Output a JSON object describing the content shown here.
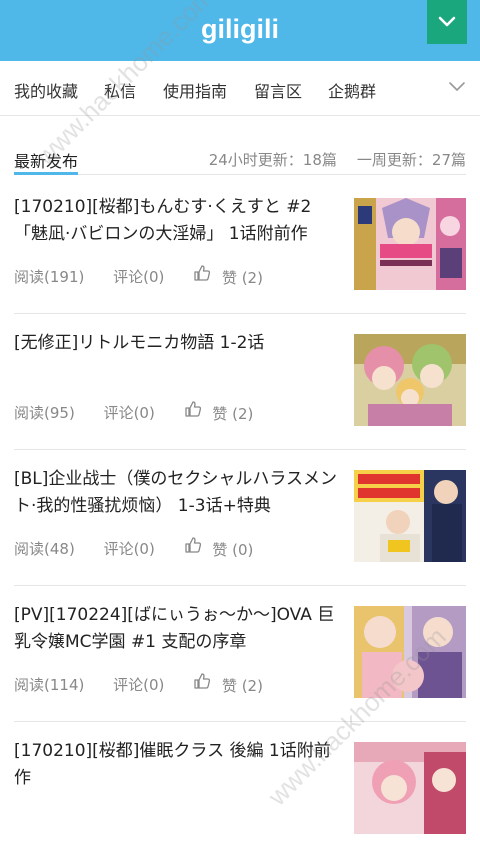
{
  "app": {
    "logo": "giligili"
  },
  "nav": {
    "items": [
      "我的收藏",
      "私信",
      "使用指南",
      "留言区",
      "企鹅群"
    ]
  },
  "section": {
    "title": "最新发布",
    "stat_24h": "24小时更新：18篇",
    "stat_week": "一周更新：27篇"
  },
  "posts": [
    {
      "title": "[170210][桜都]もんむす·くえすと #2「魅凪·バビロンの大淫婦」 1话附前作",
      "reads": "阅读(191)",
      "comments": "评论(0)",
      "likes": "赞 (2)"
    },
    {
      "title": "[无修正]リトルモニカ物語 1-2话",
      "reads": "阅读(95)",
      "comments": "评论(0)",
      "likes": "赞 (2)"
    },
    {
      "title": "[BL]企业战士（僕のセクシャルハラスメント·我的性骚扰烦恼） 1-3话+特典",
      "reads": "阅读(48)",
      "comments": "评论(0)",
      "likes": "赞 (0)"
    },
    {
      "title": "[PV][170224][ばにぃうぉ～か～]OVA 巨乳令嬢MC学園 #1 支配の序章",
      "reads": "阅读(114)",
      "comments": "评论(0)",
      "likes": "赞 (2)"
    },
    {
      "title": "[170210][桜都]催眠クラス 後編 1话附前作",
      "reads": "",
      "comments": "",
      "likes": ""
    }
  ],
  "watermarks": [
    "www.hackhome.com",
    "www.hackhome.com"
  ],
  "colors": {
    "topbar": "#4fb8e8",
    "menu_button": "#1aa77d",
    "accent": "#4fb8e8"
  }
}
